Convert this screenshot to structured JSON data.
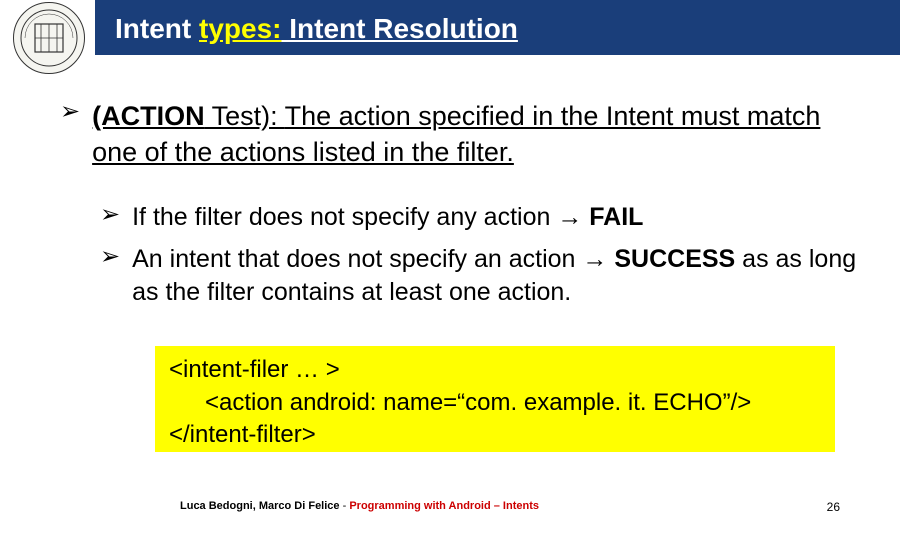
{
  "header": {
    "title_prefix": "Intent ",
    "title_types": "types:",
    "title_suffix": " Intent Resolution"
  },
  "main_bullet": {
    "label": "(ACTION",
    "label_suffix": " Test):  ",
    "text": "The action specified in the Intent must match one of the actions listed in the filter."
  },
  "sub_bullets": [
    {
      "pre": "If the filter does not specify any action ",
      "arrow": "→",
      "strong": " FAIL",
      "post": ""
    },
    {
      "pre": "An intent that does not specify an action ",
      "arrow": "→",
      "strong": " SUCCESS",
      "post": " as as long as the filter contains at least one action."
    }
  ],
  "code": {
    "line1": "<intent-filer … >",
    "line2": "<action android: name=“com. example. it. ECHO”/>",
    "line3": "</intent-filter>"
  },
  "footer": {
    "authors": "Luca Bedogni, Marco Di Felice",
    "separator": " - ",
    "subtitle": "Programming with Android – Intents",
    "page": "26"
  }
}
